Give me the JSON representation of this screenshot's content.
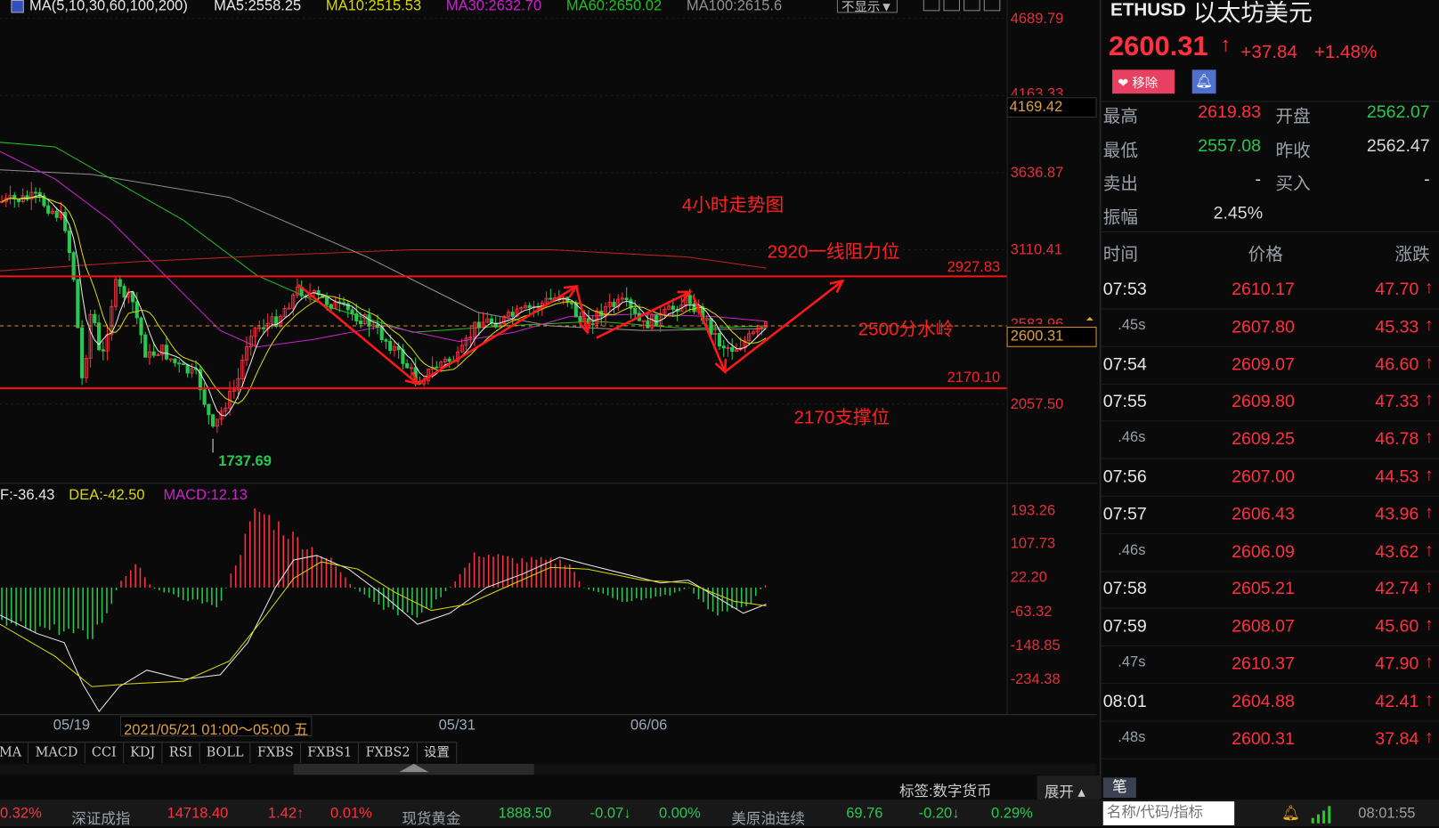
{
  "chart": {
    "ma_legend": {
      "params": "MA(5,10,30,60,100,200)",
      "ma5": "MA5:2558.25",
      "ma10": "MA10:2515.53",
      "ma30": "MA30:2632.70",
      "ma60": "MA60:2650.02",
      "ma100": "MA100:2615.6"
    },
    "display_toggle": "不显示▼",
    "price_axis": [
      "4689.79",
      "4163.33",
      "3636.87",
      "3110.41",
      "2583.96",
      "2057.50"
    ],
    "crosshair_price": "4169.42",
    "current_price_tag": "2600.31",
    "low_label": "1737.69",
    "resistance_value": "2927.83",
    "support_value": "2170.10",
    "annotations": {
      "title": "4小时走势图",
      "resistance": "2920一线阻力位",
      "pivot": "2500分水岭",
      "support": "2170支撑位"
    },
    "macd_legend": {
      "dif": "F:-36.43",
      "dea": "DEA:-42.50",
      "macd": "MACD:12.13"
    },
    "macd_axis": [
      "193.26",
      "107.73",
      "22.20",
      "-63.32",
      "-148.85",
      "-234.38"
    ],
    "date_axis": [
      "05/19",
      "05/31",
      "06/06"
    ],
    "cursor_date": "2021/05/21 01:00～05:00 五",
    "indicator_tabs": [
      "MA",
      "MACD",
      "CCI",
      "KDJ",
      "RSI",
      "BOLL",
      "FXBS",
      "FXBS1",
      "FXBS2",
      "设置"
    ],
    "colors": {
      "up": "#ff3040",
      "down": "#28c850",
      "ma5": "#e8e8e8",
      "ma10": "#d8d800",
      "ma30": "#d020d0",
      "ma60": "#20c020",
      "ma100": "#909090",
      "ma200": "#c02020"
    }
  },
  "quote": {
    "symbol": "ETHUSD",
    "name": "以太坊美元",
    "price": "2600.31",
    "change": "+37.84",
    "change_pct": "+1.48%",
    "remove_label": "移除",
    "stats": [
      {
        "label": "最高",
        "value": "2619.83",
        "label2": "开盘",
        "value2": "2562.07"
      },
      {
        "label": "最低",
        "value": "2557.08",
        "label2": "昨收",
        "value2": "2562.47"
      },
      {
        "label": "卖出",
        "value": "-",
        "label2": "买入",
        "value2": "-"
      },
      {
        "label": "振幅",
        "value": "2.45%",
        "label2": "",
        "value2": ""
      }
    ],
    "trade_headers": [
      "时间",
      "价格",
      "涨跌"
    ],
    "trades": [
      {
        "time": "07:53",
        "price": "2610.17",
        "chg": "47.70"
      },
      {
        "time": ".45s",
        "price": "2607.80",
        "chg": "45.33"
      },
      {
        "time": "07:54",
        "price": "2609.07",
        "chg": "46.60"
      },
      {
        "time": "07:55",
        "price": "2609.80",
        "chg": "47.33"
      },
      {
        "time": ".46s",
        "price": "2609.25",
        "chg": "46.78"
      },
      {
        "time": "07:56",
        "price": "2607.00",
        "chg": "44.53"
      },
      {
        "time": "07:57",
        "price": "2606.43",
        "chg": "43.96"
      },
      {
        "time": ".46s",
        "price": "2606.09",
        "chg": "43.62"
      },
      {
        "time": "07:58",
        "price": "2605.21",
        "chg": "42.74"
      },
      {
        "time": "07:59",
        "price": "2608.07",
        "chg": "45.60"
      },
      {
        "time": ".47s",
        "price": "2610.37",
        "chg": "47.90"
      },
      {
        "time": "08:01",
        "price": "2604.88",
        "chg": "42.41"
      },
      {
        "time": ".48s",
        "price": "2600.31",
        "chg": "37.84"
      }
    ],
    "tick_tab": "笔"
  },
  "label_bar": {
    "tag": "标签:数字货币",
    "expand": "展开 ▴"
  },
  "ticker": {
    "items": [
      {
        "text": "0.32%",
        "c": "red"
      },
      {
        "text": "深证成指",
        "c": "lbl"
      },
      {
        "text": "14718.40",
        "c": "red"
      },
      {
        "text": "1.42↑",
        "c": "red"
      },
      {
        "text": "0.01%",
        "c": "red"
      },
      {
        "text": "现货黄金",
        "c": "lbl"
      },
      {
        "text": "1888.50",
        "c": "grn"
      },
      {
        "text": "-0.07↓",
        "c": "grn"
      },
      {
        "text": "0.00%",
        "c": "grn"
      },
      {
        "text": "美原油连续",
        "c": "lbl"
      },
      {
        "text": "69.76",
        "c": "grn"
      },
      {
        "text": "-0.20↓",
        "c": "grn"
      },
      {
        "text": "0.29%",
        "c": "grn"
      }
    ],
    "search_placeholder": "名称/代码/指标",
    "clock": "08:01:55"
  }
}
